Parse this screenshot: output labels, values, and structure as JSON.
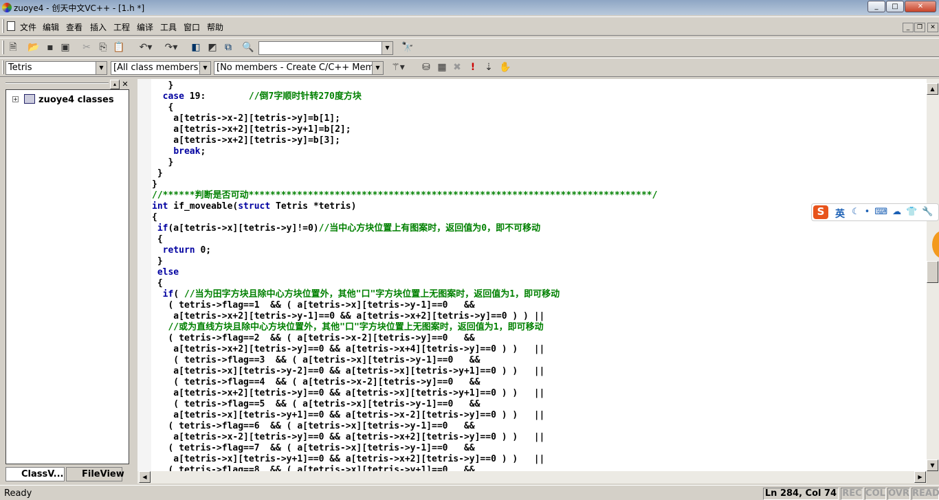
{
  "window": {
    "title": "zuoye4 - 创天中文VC++ - [1.h *]",
    "min": "_",
    "max": "□",
    "close": "✕"
  },
  "menu": [
    "文件",
    "编辑",
    "查看",
    "插入",
    "工程",
    "编译",
    "工具",
    "窗口",
    "帮助"
  ],
  "toolbar2": {
    "class_combo": "Tetris",
    "filter_combo": "[All class members]",
    "members_combo": "[No members - Create C/C++ Memb"
  },
  "find_combo": {
    "value": ""
  },
  "left_pane": {
    "tree_root": "zuoye4 classes",
    "tabs": [
      "ClassV...",
      "FileView"
    ]
  },
  "code_lines": [
    [
      [
        "n",
        "   }"
      ]
    ],
    [
      [
        "n",
        "  "
      ],
      [
        "k",
        "case"
      ],
      [
        "n",
        " 19:        "
      ],
      [
        "c",
        "//倒7字顺时针转270度方块"
      ]
    ],
    [
      [
        "n",
        "   {"
      ]
    ],
    [
      [
        "n",
        "    a[tetris->x-2][tetris->y]=b[1];"
      ]
    ],
    [
      [
        "n",
        "    a[tetris->x+2][tetris->y+1]=b[2];"
      ]
    ],
    [
      [
        "n",
        "    a[tetris->x+2][tetris->y]=b[3];"
      ]
    ],
    [
      [
        "n",
        "    "
      ],
      [
        "k",
        "break"
      ],
      [
        "n",
        ";"
      ]
    ],
    [
      [
        "n",
        "   }"
      ]
    ],
    [
      [
        "n",
        " }"
      ]
    ],
    [
      [
        "n",
        "}"
      ]
    ],
    [
      [
        "c",
        "//******判断是否可动***************************************************************************/"
      ]
    ],
    [
      [
        "k",
        "int"
      ],
      [
        "n",
        " if_moveable("
      ],
      [
        "k",
        "struct"
      ],
      [
        "n",
        " Tetris *tetris)"
      ]
    ],
    [
      [
        "n",
        "{"
      ]
    ],
    [
      [
        "n",
        " "
      ],
      [
        "k",
        "if"
      ],
      [
        "n",
        "(a[tetris->x][tetris->y]!=0)"
      ],
      [
        "c",
        "//当中心方块位置上有图案时，返回值为0，即不可移动"
      ]
    ],
    [
      [
        "n",
        " {"
      ]
    ],
    [
      [
        "n",
        "  "
      ],
      [
        "k",
        "return"
      ],
      [
        "n",
        " 0;"
      ]
    ],
    [
      [
        "n",
        " }"
      ]
    ],
    [
      [
        "n",
        " "
      ],
      [
        "k",
        "else"
      ]
    ],
    [
      [
        "n",
        " {"
      ]
    ],
    [
      [
        "n",
        "  "
      ],
      [
        "k",
        "if"
      ],
      [
        "n",
        "( "
      ],
      [
        "c",
        "//当为田字方块且除中心方块位置外，其他\"口\"字方块位置上无图案时，返回值为1，即可移动"
      ]
    ],
    [
      [
        "n",
        "   ( tetris->flag==1  && ( a[tetris->x][tetris->y-1]==0   &&"
      ]
    ],
    [
      [
        "n",
        "    a[tetris->x+2][tetris->y-1]==0 && a[tetris->x+2][tetris->y]==0 ) ) ||"
      ]
    ],
    [
      [
        "n",
        "   "
      ],
      [
        "c",
        "//或为直线方块且除中心方块位置外，其他\"口\"字方块位置上无图案时，返回值为1，即可移动"
      ]
    ],
    [
      [
        "n",
        "   ( tetris->flag==2  && ( a[tetris->x-2][tetris->y]==0   &&"
      ]
    ],
    [
      [
        "n",
        "    a[tetris->x+2][tetris->y]==0 && a[tetris->x+4][tetris->y]==0 ) )   ||"
      ]
    ],
    [
      [
        "n",
        "    ( tetris->flag==3  && ( a[tetris->x][tetris->y-1]==0   &&"
      ]
    ],
    [
      [
        "n",
        "    a[tetris->x][tetris->y-2]==0 && a[tetris->x][tetris->y+1]==0 ) )   ||"
      ]
    ],
    [
      [
        "n",
        "    ( tetris->flag==4  && ( a[tetris->x-2][tetris->y]==0   &&"
      ]
    ],
    [
      [
        "n",
        "    a[tetris->x+2][tetris->y]==0 && a[tetris->x][tetris->y+1]==0 ) )   ||"
      ]
    ],
    [
      [
        "n",
        "    ( tetris->flag==5  && ( a[tetris->x][tetris->y-1]==0   &&"
      ]
    ],
    [
      [
        "n",
        "    a[tetris->x][tetris->y+1]==0 && a[tetris->x-2][tetris->y]==0 ) )   ||"
      ]
    ],
    [
      [
        "n",
        "   ( tetris->flag==6  && ( a[tetris->x][tetris->y-1]==0   &&"
      ]
    ],
    [
      [
        "n",
        "    a[tetris->x-2][tetris->y]==0 && a[tetris->x+2][tetris->y]==0 ) )   ||"
      ]
    ],
    [
      [
        "n",
        "   ( tetris->flag==7  && ( a[tetris->x][tetris->y-1]==0   &&"
      ]
    ],
    [
      [
        "n",
        "    a[tetris->x][tetris->y+1]==0 && a[tetris->x+2][tetris->y]==0 ) )   ||"
      ]
    ],
    [
      [
        "n",
        "   ( tetris->flag==8  && ( a[tetris->x][tetris->y+1]==0   &&"
      ]
    ]
  ],
  "colors": {
    "keyword": "#0000a0",
    "comment": "#008000"
  },
  "status": {
    "ready": "Ready",
    "position": "Ln 284, Col 74",
    "rec": "REC",
    "col": "COL",
    "ovr": "OVR",
    "read": "READ"
  },
  "ime": {
    "lang": "英",
    "logo": "S"
  }
}
